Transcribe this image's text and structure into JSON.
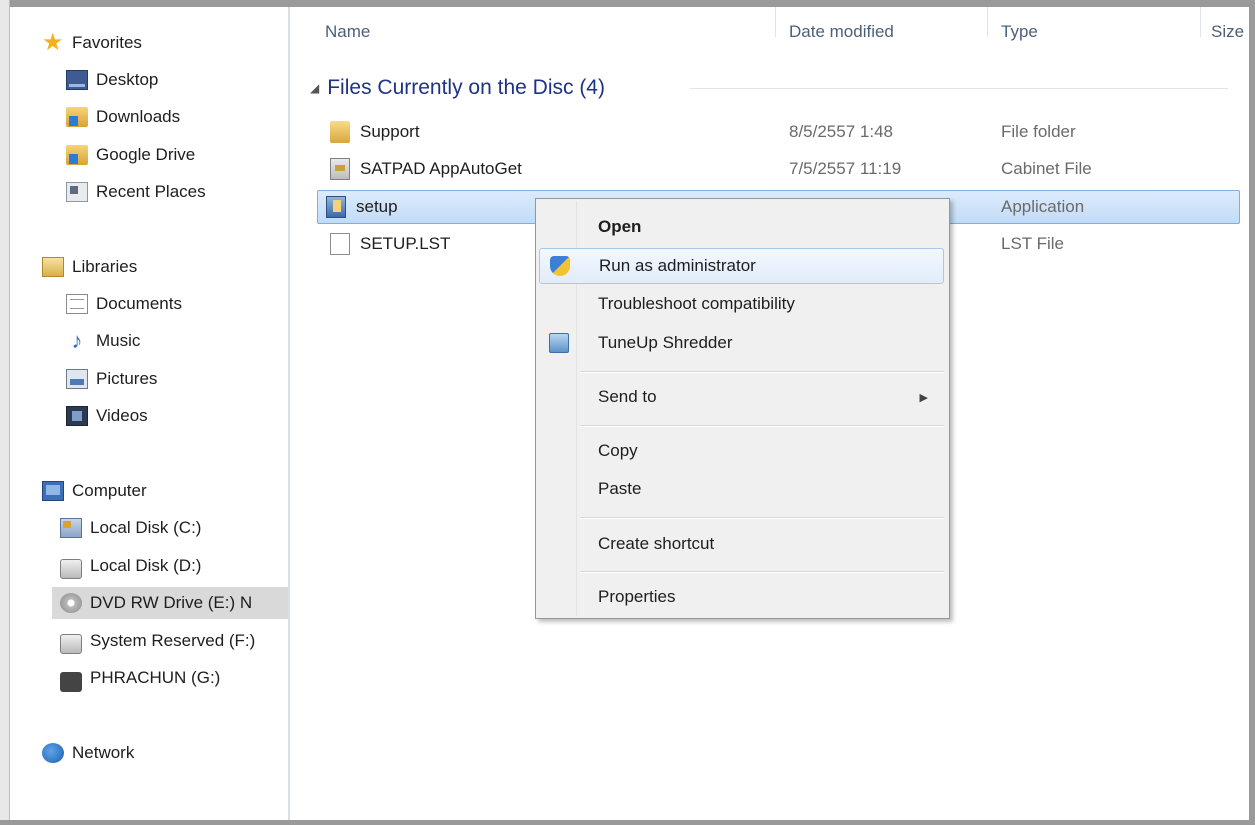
{
  "nav": {
    "favorites": {
      "label": "Favorites",
      "items": [
        {
          "label": "Desktop"
        },
        {
          "label": "Downloads"
        },
        {
          "label": "Google Drive"
        },
        {
          "label": "Recent Places"
        }
      ]
    },
    "libraries": {
      "label": "Libraries",
      "items": [
        {
          "label": "Documents"
        },
        {
          "label": "Music"
        },
        {
          "label": "Pictures"
        },
        {
          "label": "Videos"
        }
      ]
    },
    "computer": {
      "label": "Computer",
      "items": [
        {
          "label": "Local Disk (C:)"
        },
        {
          "label": "Local Disk (D:)"
        },
        {
          "label": "DVD RW Drive (E:) N",
          "selected": true
        },
        {
          "label": "System Reserved (F:)"
        },
        {
          "label": "PHRACHUN (G:)"
        }
      ]
    },
    "network": {
      "label": "Network"
    }
  },
  "columns": {
    "name": "Name",
    "date_modified": "Date modified",
    "type": "Type",
    "size": "Size"
  },
  "group": {
    "label": "Files Currently on the Disc (4)"
  },
  "files": [
    {
      "name": "Support",
      "date": "8/5/2557 1:48",
      "type": "File folder",
      "icon": "folder-icon"
    },
    {
      "name": "SATPAD AppAutoGet",
      "date": "7/5/2557 11:19",
      "type": "Cabinet File",
      "icon": "cabinet-file-icon"
    },
    {
      "name": "setup",
      "date": "",
      "type": "Application",
      "icon": "application-icon",
      "selected": true
    },
    {
      "name": "SETUP.LST",
      "date": "",
      "type": "LST File",
      "icon": "file-icon"
    }
  ],
  "context_menu": {
    "open": "Open",
    "run_as_admin": "Run as administrator",
    "troubleshoot": "Troubleshoot compatibility",
    "tuneup_shredder": "TuneUp Shredder",
    "send_to": "Send to",
    "copy": "Copy",
    "paste": "Paste",
    "create_shortcut": "Create shortcut",
    "properties": "Properties"
  },
  "colors": {
    "selection": "#c2dcf7",
    "group_header": "#1e3287",
    "menu_bg": "#f0f0f0",
    "nav_selected": "#d9d9d9"
  }
}
